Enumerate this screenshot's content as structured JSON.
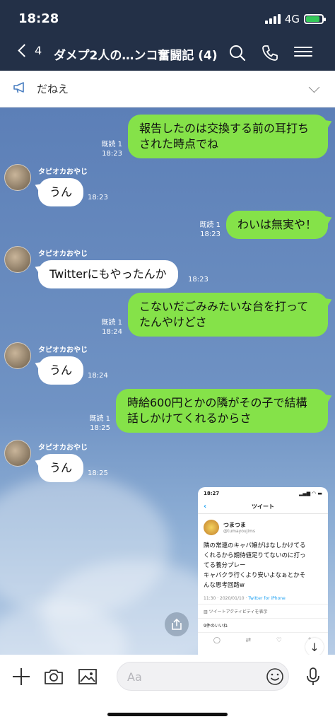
{
  "status_bar": {
    "time": "18:28",
    "network": "4G"
  },
  "header": {
    "back_count": "4",
    "title": "ダメプ2人の…ンコ奮闘記 (4)"
  },
  "announcement": {
    "text": "だねえ"
  },
  "messages": [
    {
      "side": "right",
      "lines": [
        "報告したのは交換する前の耳打ち",
        "された時点でね"
      ],
      "read": "既読 1",
      "time": "18:23"
    },
    {
      "side": "left",
      "sender": "タピオカおやじ",
      "text": "うん",
      "time": "18:23"
    },
    {
      "side": "right",
      "lines": [
        "わいは無実や！"
      ],
      "read": "既読 1",
      "time": "18:23"
    },
    {
      "side": "left",
      "sender": "タピオカおやじ",
      "text": "Twitterにもやったんか",
      "time": "18:23"
    },
    {
      "side": "right",
      "lines": [
        "こないだごみみたいな台を打って",
        "たんやけどさ"
      ],
      "read": "既読 1",
      "time": "18:24"
    },
    {
      "side": "left",
      "sender": "タピオカおやじ",
      "text": "うん",
      "time": "18:24"
    },
    {
      "side": "right",
      "lines": [
        "時給600円とかの隣がその子で結構",
        "話しかけてくれるからさ"
      ],
      "read": "既読 1",
      "time": "18:25"
    },
    {
      "side": "left",
      "sender": "タピオカおやじ",
      "text": "うん",
      "time": "18:25"
    }
  ],
  "screenshot": {
    "time": "18:27",
    "nav_title": "ツイート",
    "user_name": "つまつま",
    "user_handle": "@tumayoujims",
    "tweet_lines": [
      "隣の常連のキャバ嬢がはなしかけてる",
      "くれるから期待値足りてないのに打っ",
      "てる養分プレー",
      "キャバクラ行くより安いよなぁとかそ",
      "んな思考回路w"
    ],
    "meta_time": "11:30 · 2020/01/10 · ",
    "meta_source": "Twitter for iPhone",
    "activity": "ツイートアクティビティを表示",
    "likes": "9件のいいね"
  },
  "input": {
    "placeholder": "Aa"
  },
  "colors": {
    "header": "#233047",
    "bubble_right": "#85e249",
    "bubble_left": "#ffffff"
  }
}
